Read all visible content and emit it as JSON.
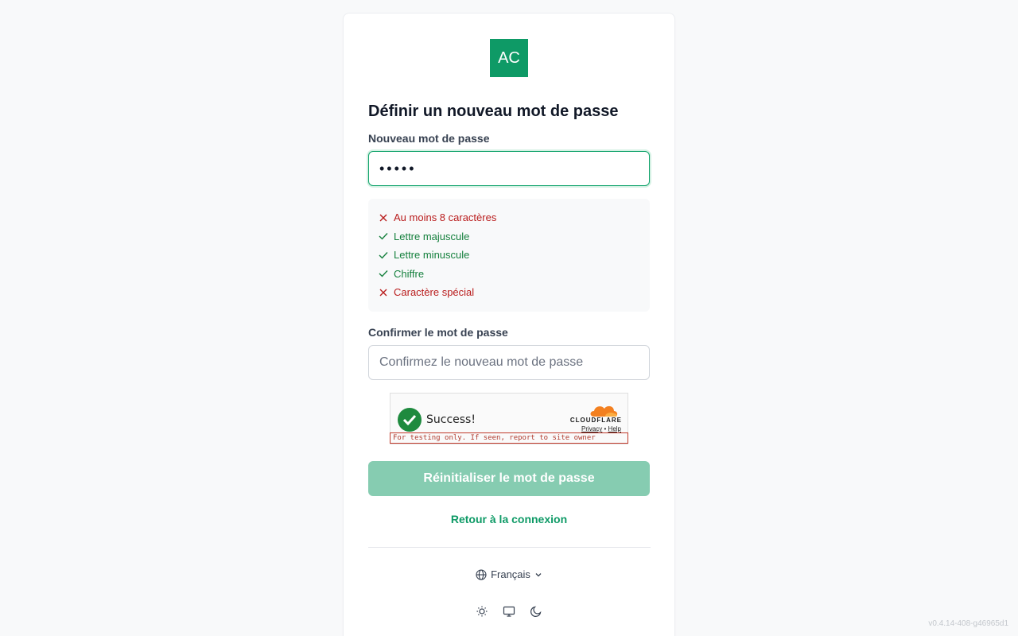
{
  "logo": {
    "text": "AC",
    "color": "#0e9a66"
  },
  "title": "Définir un nouveau mot de passe",
  "new_password": {
    "label": "Nouveau mot de passe",
    "value": "•••••"
  },
  "requirements": [
    {
      "text": "Au moins 8 caractères",
      "met": false
    },
    {
      "text": "Lettre majuscule",
      "met": true
    },
    {
      "text": "Lettre minuscule",
      "met": true
    },
    {
      "text": "Chiffre",
      "met": true
    },
    {
      "text": "Caractère spécial",
      "met": false
    }
  ],
  "confirm_password": {
    "label": "Confirmer le mot de passe",
    "placeholder": "Confirmez le nouveau mot de passe"
  },
  "captcha": {
    "status": "Success!",
    "brand": "CLOUDFLARE",
    "privacy": "Privacy",
    "separator": "•",
    "help": "Help",
    "testing_notice": "For testing only. If seen, report to site owner"
  },
  "submit_label": "Réinitialiser le mot de passe",
  "back_link": "Retour à la connexion",
  "language": {
    "selected": "Français",
    "icon": "globe-icon"
  },
  "theme_icons": [
    "sun-icon",
    "monitor-icon",
    "moon-icon"
  ],
  "version": "v0.4.14-408-g46965d1",
  "colors": {
    "accent": "#0e9a66",
    "button_disabled": "#86ccb1",
    "error": "#b91c1c",
    "success": "#15803d"
  }
}
